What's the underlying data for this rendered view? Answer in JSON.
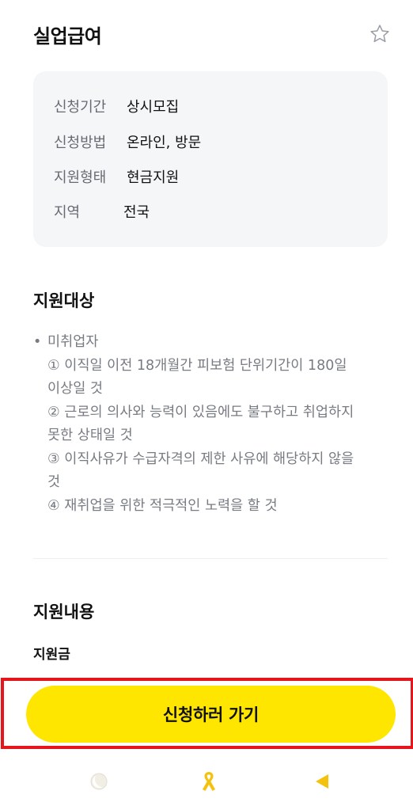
{
  "header": {
    "title": "실업급여"
  },
  "info": {
    "rows": [
      {
        "label": "신청기간",
        "value": "상시모집"
      },
      {
        "label": "신청방법",
        "value": "온라인, 방문"
      },
      {
        "label": "지원형태",
        "value": "현금지원"
      },
      {
        "label": "지역",
        "value": "전국"
      }
    ]
  },
  "target": {
    "title": "지원대상",
    "bullet": "미취업자",
    "items": [
      "① 이직일 이전 18개월간 피보험 단위기간이 180일",
      "이상일 것",
      "② 근로의 의사와 능력이 있음에도 불구하고 취업하지",
      "못한 상태일 것",
      "③ 이직사유가 수급자격의 제한 사유에 해당하지 않을",
      "것",
      "④ 재취업을 위한 적극적인 노력을 할 것"
    ]
  },
  "content": {
    "title": "지원내용",
    "subtitle": "지원금"
  },
  "cta": {
    "label": "신청하러 가기"
  },
  "nav": {
    "icons": [
      "moon-icon",
      "ribbon-icon",
      "back-icon"
    ]
  },
  "colors": {
    "accent": "#ffe600",
    "highlight": "#e4161c",
    "ribbon": "#f4c20d"
  }
}
